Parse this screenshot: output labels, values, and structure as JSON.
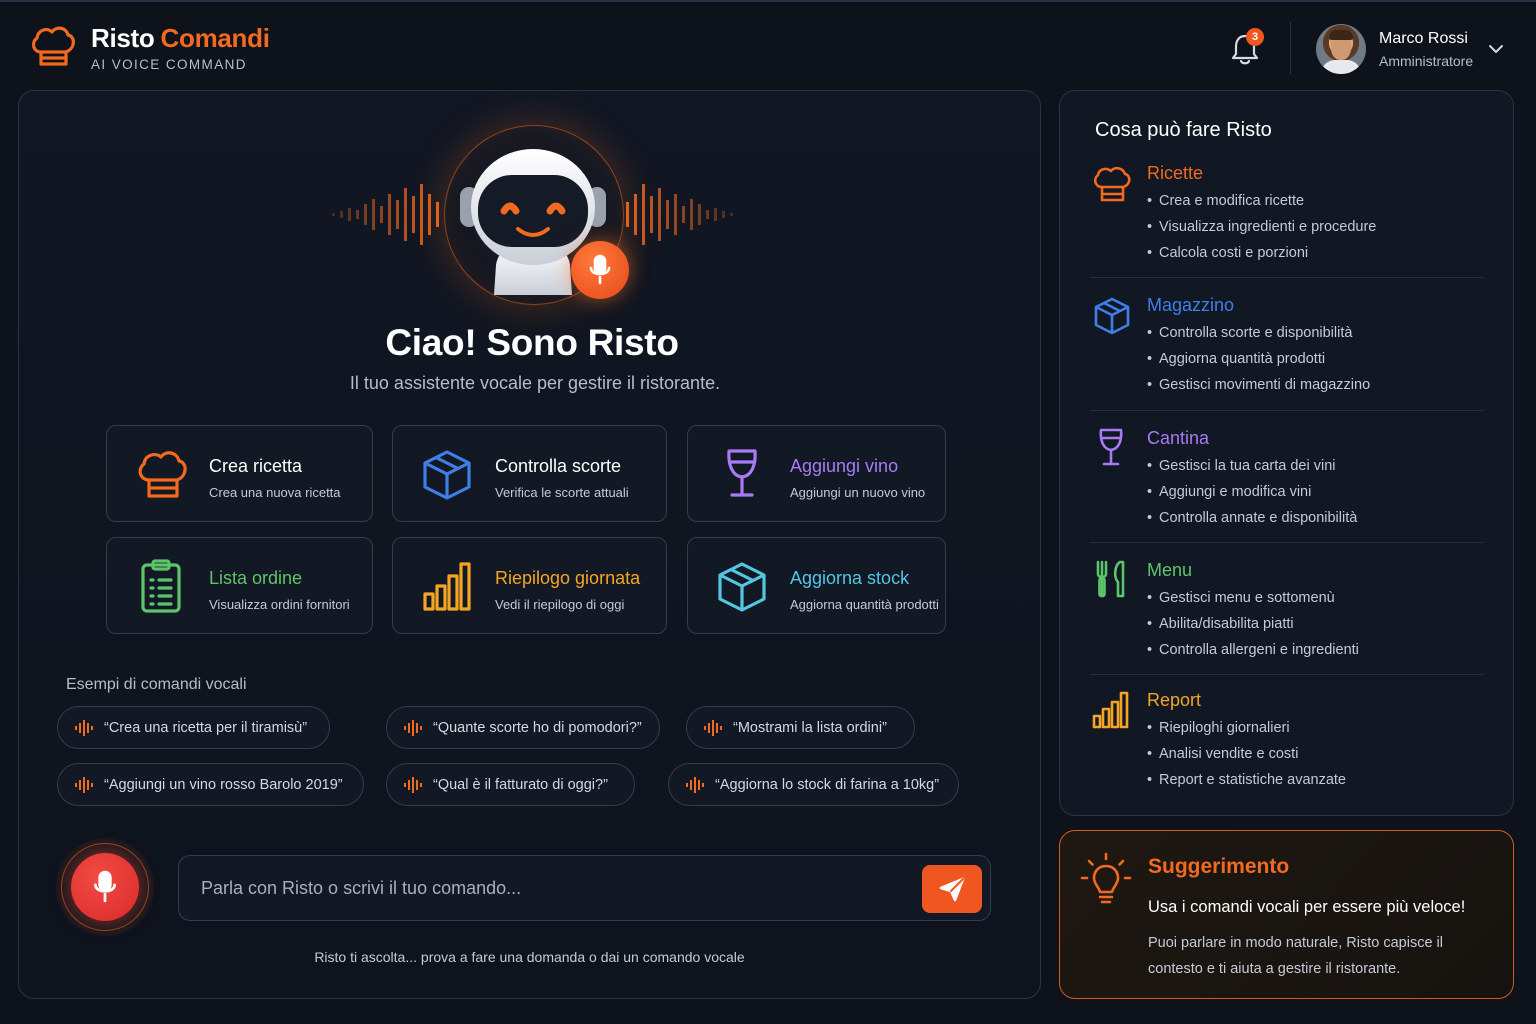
{
  "app": {
    "title_part1": "Risto",
    "title_part2": "Comandi",
    "subtitle": "AI VOICE COMMAND",
    "logo_icon": "chef-hat-icon",
    "accent": "#f26a1f"
  },
  "header": {
    "notification_count": "3",
    "user": {
      "name": "Marco Rossi",
      "role": "Amministratore"
    }
  },
  "hero": {
    "title": "Ciao! Sono Risto",
    "subtitle": "Il tuo assistente vocale per gestire il ristorante."
  },
  "actions": [
    {
      "title": "Crea ricetta",
      "desc": "Crea una nuova ricetta",
      "icon": "chef-hat-icon",
      "color": "#ffffff"
    },
    {
      "title": "Controlla scorte",
      "desc": "Verifica le scorte attuali",
      "icon": "box-icon",
      "color": "#ffffff"
    },
    {
      "title": "Aggiungi vino",
      "desc": "Aggiungi un nuovo vino",
      "icon": "wine-glass-icon",
      "color": "#a77bf3"
    },
    {
      "title": "Lista ordine",
      "desc": "Visualizza ordini fornitori",
      "icon": "clipboard-list-icon",
      "color": "#5ec46a"
    },
    {
      "title": "Riepilogo giornata",
      "desc": "Vedi il riepilogo di oggi",
      "icon": "bar-chart-icon",
      "color": "#f5a524"
    },
    {
      "title": "Aggiorna stock",
      "desc": "Aggiorna quantità prodotti",
      "icon": "box-icon",
      "color": "#52c6e3"
    }
  ],
  "examples": {
    "label": "Esempi di comandi vocali",
    "items": [
      "“Crea una ricetta per il tiramisù”",
      "“Quante scorte ho di pomodori?”",
      "“Mostrami la lista ordini”",
      "“Aggiungi un vino rosso Barolo 2019”",
      "“Qual è il fatturato di oggi?”",
      "“Aggiorna lo stock di farina a 10kg”"
    ]
  },
  "input": {
    "placeholder": "Parla con Risto o scrivi il tuo comando...",
    "hint": "Risto ti ascolta... prova a fare una domanda o dai un comando vocale"
  },
  "capabilities": {
    "title": "Cosa può fare Risto",
    "sections": [
      {
        "title": "Ricette",
        "color": "#f26a1f",
        "icon": "chef-hat-icon",
        "items": [
          "Crea e modifica ricette",
          "Visualizza ingredienti e procedure",
          "Calcola costi e porzioni"
        ]
      },
      {
        "title": "Magazzino",
        "color": "#3f7fe8",
        "icon": "box-icon",
        "items": [
          "Controlla scorte e disponibilità",
          "Aggiorna quantità prodotti",
          "Gestisci movimenti di magazzino"
        ]
      },
      {
        "title": "Cantina",
        "color": "#a77bf3",
        "icon": "wine-glass-icon",
        "items": [
          "Gestisci la tua carta dei vini",
          "Aggiungi e modifica vini",
          "Controlla annate e disponibilità"
        ]
      },
      {
        "title": "Menu",
        "color": "#5ec46a",
        "icon": "fork-knife-icon",
        "items": [
          "Gestisci menu e sottomenù",
          "Abilita/disabilita piatti",
          "Controlla allergeni e ingredienti"
        ]
      },
      {
        "title": "Report",
        "color": "#f5a524",
        "icon": "bar-chart-icon",
        "items": [
          "Riepiloghi giornalieri",
          "Analisi vendite e costi",
          "Report e statistiche avanzate"
        ]
      }
    ]
  },
  "tip": {
    "title": "Suggerimento",
    "headline": "Usa i comandi vocali per essere più veloce!",
    "body": "Puoi parlare in modo naturale, Risto capisce il contesto e ti aiuta a gestire il ristorante.",
    "icon": "lightbulb-icon"
  }
}
